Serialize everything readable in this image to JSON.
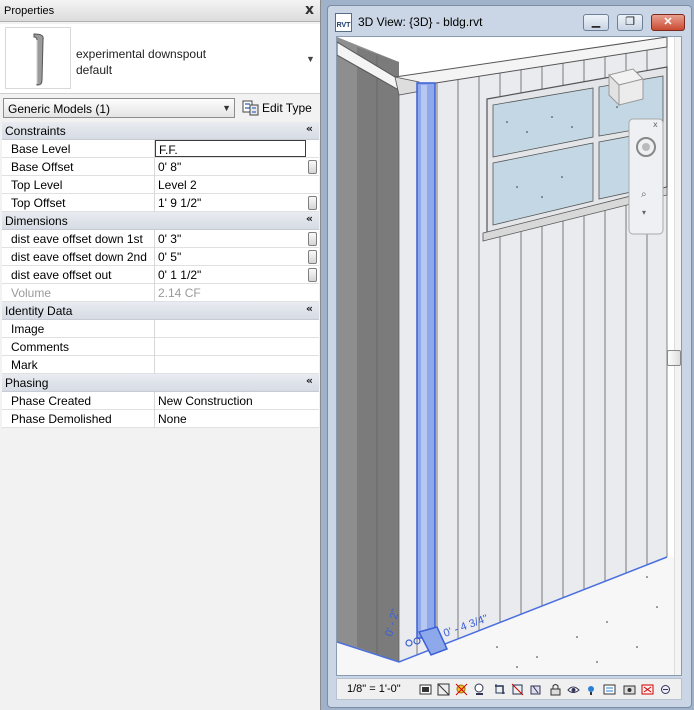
{
  "properties": {
    "title": "Properties",
    "close_glyph": "x",
    "type_name_line1": "experimental downspout",
    "type_name_line2": "default",
    "category": "Generic Models (1)",
    "edit_type": "Edit Type",
    "groups": {
      "constraints": "Constraints",
      "dimensions": "Dimensions",
      "identity": "Identity Data",
      "phasing": "Phasing"
    },
    "rows": {
      "base_level": {
        "label": "Base Level",
        "value": "F.F."
      },
      "base_offset": {
        "label": "Base Offset",
        "value": "0'  8\""
      },
      "top_level": {
        "label": "Top Level",
        "value": "Level 2"
      },
      "top_offset": {
        "label": "Top Offset",
        "value": "1'  9 1/2\""
      },
      "eave_down_1st": {
        "label": "dist eave offset down 1st",
        "value": "0'  3\""
      },
      "eave_down_2nd": {
        "label": "dist eave offset down 2nd",
        "value": "0'  5\""
      },
      "eave_out": {
        "label": "dist eave offset out",
        "value": "0'  1 1/2\""
      },
      "volume": {
        "label": "Volume",
        "value": "2.14 CF"
      },
      "image": {
        "label": "Image",
        "value": ""
      },
      "comments": {
        "label": "Comments",
        "value": ""
      },
      "mark": {
        "label": "Mark",
        "value": ""
      },
      "phase_created": {
        "label": "Phase Created",
        "value": "New Construction"
      },
      "phase_demolished": {
        "label": "Phase Demolished",
        "value": "None"
      }
    }
  },
  "view": {
    "title": "3D View: {3D} - bldg.rvt",
    "icon_text": "RVT",
    "scale": "1/8\" = 1'-0\"",
    "dim_labels": [
      "0' - 2\"",
      "0' - 4 3/4\""
    ]
  },
  "colors": {
    "selection_blue": "#4a6fe0",
    "siding": "#e9ebee",
    "glass": "#c3d8e4"
  }
}
